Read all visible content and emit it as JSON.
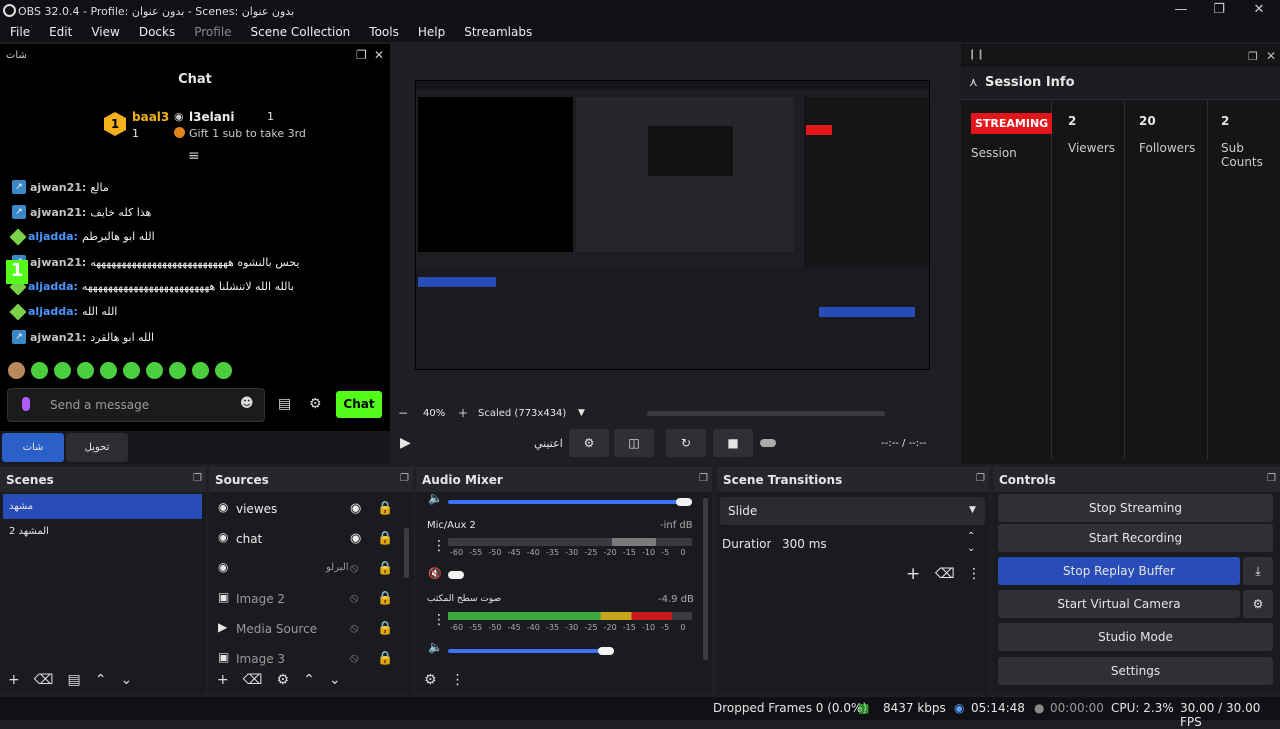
{
  "window": {
    "title": "OBS 32.0.4 - Profile: بدون عنوان - Scenes: بدون عنوان"
  },
  "menu": [
    "File",
    "Edit",
    "View",
    "Docks",
    "Profile",
    "Scene Collection",
    "Tools",
    "Help",
    "Streamlabs"
  ],
  "chat": {
    "dock_title": "شات",
    "title": "Chat",
    "leader1": {
      "name": "baal3",
      "count": "1"
    },
    "leader2": {
      "name": "l3elani",
      "count": "1"
    },
    "gift_text": "Gift 1 sub to take 3rd",
    "messages": [
      {
        "user": "ajwan21:",
        "text": "مالع",
        "blue": false
      },
      {
        "user": "ajwan21:",
        "text": "هذا كله خايف",
        "blue": false
      },
      {
        "user": "aljadda:",
        "text": "الله ابو هالبرطم",
        "blue": true
      },
      {
        "user": "ajwan21:",
        "text": "يحس بالنشوه هههههههههههههههههههههههههههه",
        "blue": false
      },
      {
        "user": "aljadda:",
        "text": "بالله الله لاتنشلنا هههههههههههههههههههههههههه",
        "blue": true
      },
      {
        "user": "aljadda:",
        "text": "الله الله",
        "blue": true
      },
      {
        "user": "ajwan21:",
        "text": "الله ابو هالقرد",
        "blue": false
      }
    ],
    "placeholder": "Send a message",
    "send_label": "Chat",
    "tab1": "شات",
    "tab2": "تحويل",
    "overlay_num": "1"
  },
  "preview": {
    "zoom": "40%",
    "scale": "Scaled (773x434)",
    "scene_name": "اعتيني",
    "time": "--:-- / --:--"
  },
  "session": {
    "title": "Session Info",
    "status": "STREAMING",
    "status_label": "Session",
    "stats": [
      {
        "value": "2",
        "label": "Viewers"
      },
      {
        "value": "20",
        "label": "Followers"
      },
      {
        "value": "2",
        "label": "Sub Counts"
      }
    ]
  },
  "scenes": {
    "title": "Scenes",
    "items": [
      "مشهد",
      "المشهد 2"
    ]
  },
  "sources": {
    "title": "Sources",
    "items": [
      {
        "name": "viewes",
        "hidden": false
      },
      {
        "name": "chat",
        "hidden": false
      },
      {
        "name": "البرلو",
        "hidden": true
      },
      {
        "name": "Image 2",
        "hidden": true
      },
      {
        "name": "Media Source",
        "hidden": true
      },
      {
        "name": "Image 3",
        "hidden": true
      }
    ]
  },
  "audio": {
    "title": "Audio Mixer",
    "ch1": {
      "name": "Mic/Aux 2",
      "db": "-inf dB"
    },
    "ch2": {
      "name": "صوت سطح المكتب",
      "db": "-4.9 dB"
    },
    "scale": [
      "-60",
      "-55",
      "-50",
      "-45",
      "-40",
      "-35",
      "-30",
      "-25",
      "-20",
      "-15",
      "-10",
      "-5",
      "0"
    ],
    "desktop_level": 0.92,
    "mic_level": 0.8
  },
  "transitions": {
    "title": "Scene Transitions",
    "selected": "Slide",
    "duration_label": "Duration",
    "duration": "300 ms"
  },
  "controls": {
    "title": "Controls",
    "buttons": {
      "stop_stream": "Stop Streaming",
      "start_rec": "Start Recording",
      "stop_replay": "Stop Replay Buffer",
      "virtual_cam": "Start Virtual Camera",
      "studio": "Studio Mode",
      "settings": "Settings"
    }
  },
  "status": {
    "dropped": "Dropped Frames 0 (0.0%)",
    "kbps": "8437 kbps",
    "stream_time": "05:14:48",
    "rec_time": "00:00:00",
    "cpu": "CPU: 2.3%",
    "fps": "30.00 / 30.00 FPS"
  },
  "colors": {
    "accent": "#284cb8",
    "kick_green": "#53fc18",
    "streaming_red": "#e5161b"
  }
}
